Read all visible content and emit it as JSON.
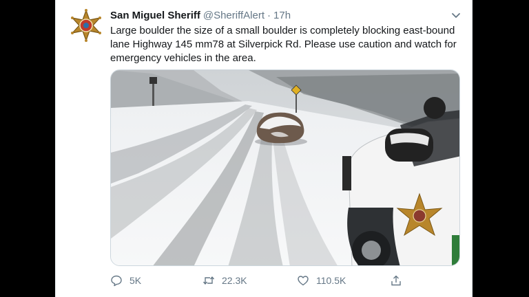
{
  "tweet": {
    "display_name": "San Miguel Sheriff",
    "handle": "@SheriffAlert",
    "separator": "·",
    "time": "17h",
    "text": "Large boulder the size of a small boulder is completely blocking east-bound lane Highway 145 mm78 at Silverpick Rd. Please use caution and watch for emergency vehicles in the area."
  },
  "actions": {
    "replies": "5K",
    "retweets": "22.3K",
    "likes": "110.5K"
  },
  "icons": {
    "avatar": "sheriff-star-badge",
    "menu": "chevron-down-icon",
    "reply": "speech-bubble-icon",
    "retweet": "retweet-arrows-icon",
    "like": "heart-icon",
    "share": "share-upload-icon"
  },
  "colors": {
    "text": "#14171a",
    "secondary": "#657786",
    "badge_gold": "#b8862b",
    "badge_red": "#c0392b"
  }
}
